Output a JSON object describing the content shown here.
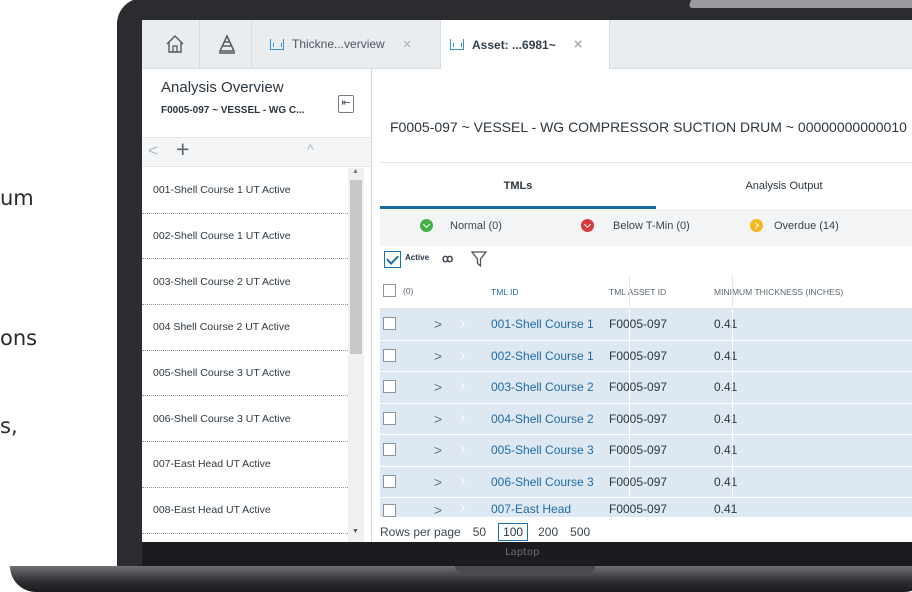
{
  "background_text": [
    "um",
    "ons",
    "s,"
  ],
  "laptop": {
    "label": "Laptop"
  },
  "tabs": {
    "home_icon": "home-icon",
    "triangle_icon": "triangle-icon",
    "items": [
      {
        "label": "Thickne...verview",
        "close": "×",
        "active": false
      },
      {
        "label": "Asset: ...6981~",
        "close": "×",
        "active": true
      }
    ]
  },
  "left_panel": {
    "title": "Analysis Overview",
    "subtitle": "F0005-097 ~ VESSEL - WG C...",
    "collapse_glyph": "⇤",
    "tools": {
      "prev": "<",
      "add": "+",
      "up": "^"
    },
    "items": [
      "001-Shell Course 1 UT Active",
      "002-Shell Course 1 UT Active",
      "003-Shell Course 2 UT Active",
      "004 Shell Course 2 UT Active",
      "005-Shell Course 3 UT Active",
      "006-Shell Course 3 UT Active",
      "007-East Head UT Active",
      "008-East Head UT Active"
    ]
  },
  "main": {
    "asset_title": "F0005-097 ~ VESSEL - WG COMPRESSOR SUCTION DRUM ~ 00000000000010",
    "sub_tabs": [
      {
        "label": "TMLs",
        "active": true
      },
      {
        "label": "Analysis Output",
        "active": false
      }
    ],
    "filters": [
      {
        "label": "Normal (0)",
        "color": "#43b04a"
      },
      {
        "label": "Below T-Min (0)",
        "color": "#d63b3b"
      },
      {
        "label": "Overdue (14)",
        "color": "#f5b81c"
      }
    ],
    "active_label": "Active",
    "binoculars": "ꝏ",
    "grid": {
      "select_count": "(0)",
      "columns": [
        "TML ID",
        "TML ASSET ID",
        "MINIMUM THICKNESS (INCHES)"
      ],
      "rows": [
        {
          "expand": ">",
          "tml_id": "001-Shell Course 1",
          "asset_id": "F0005-097",
          "min_thickness": "0.41"
        },
        {
          "expand": ">",
          "tml_id": "002-Shell Course 1",
          "asset_id": "F0005-097",
          "min_thickness": "0.41"
        },
        {
          "expand": ">",
          "tml_id": "003-Shell Course 2",
          "asset_id": "F0005-097",
          "min_thickness": "0.41"
        },
        {
          "expand": ">",
          "tml_id": "004-Shell Course 2",
          "asset_id": "F0005-097",
          "min_thickness": "0.41"
        },
        {
          "expand": ">",
          "tml_id": "005-Shell Course 3",
          "asset_id": "F0005-097",
          "min_thickness": "0.41"
        },
        {
          "expand": ">",
          "tml_id": "006-Shell Course 3",
          "asset_id": "F0005-097",
          "min_thickness": "0.41"
        },
        {
          "expand": ">",
          "tml_id": "007-East Head",
          "asset_id": "F0005-097",
          "min_thickness": "0.41"
        }
      ]
    },
    "pager": {
      "label": "Rows per page",
      "options": [
        "50",
        "100",
        "200",
        "500"
      ],
      "selected": "100"
    }
  }
}
